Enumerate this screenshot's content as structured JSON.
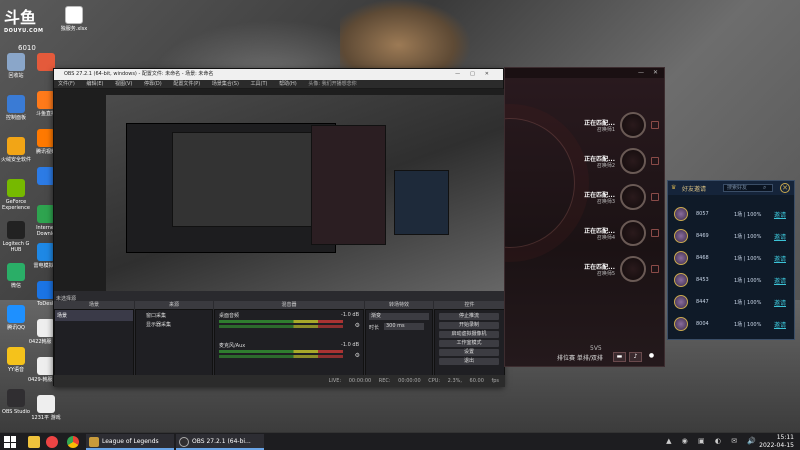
{
  "branding": {
    "logo_text": "斗鱼",
    "logo_sub": "DOUYU.COM",
    "room_id": "6010"
  },
  "desktop_icons": [
    {
      "label": "回收站",
      "color": "#8aa6c9"
    },
    {
      "label": "控制面板",
      "color": "#3a7bd5"
    },
    {
      "label": "火绒安全软件",
      "color": "#f2a516"
    },
    {
      "label": "GeForce Experience",
      "color": "#76b900"
    },
    {
      "label": "Logitech G HUB",
      "color": "#222"
    },
    {
      "label": "微信",
      "color": "#2aae67"
    },
    {
      "label": "腾讯QQ",
      "color": "#1e90ff"
    },
    {
      "label": "YY语音",
      "color": "#f5c21b"
    },
    {
      "label": "OBS Studio",
      "color": "#302e31"
    }
  ],
  "desktop_icons_col2": [
    {
      "label": "",
      "color": "#e45a3b"
    },
    {
      "label": "斗鱼直播",
      "color": "#ff7a1a"
    },
    {
      "label": "腾讯视频",
      "color": "#ff7900"
    },
    {
      "label": "",
      "color": "#2c7be5"
    },
    {
      "label": "Internet Downlo",
      "color": "#2ea44f"
    },
    {
      "label": "雷电模拟器",
      "color": "#1e88e5"
    },
    {
      "label": "ToDesk",
      "color": "#1b74e4"
    },
    {
      "label": "0422韩服 通用",
      "color": "#eee"
    },
    {
      "label": "0429-韩服 游戏",
      "color": "#eee"
    },
    {
      "label": "1231平 游戏",
      "color": "#eee"
    }
  ],
  "desktop_files_top": [
    {
      "label": "独服务.xlsx"
    },
    {
      "label": "独服务"
    }
  ],
  "obs": {
    "title": "OBS 27.2.1 (64-bit, windows) - 配置文件: 未命名 - 场景: 未命名",
    "menu": [
      "文件(F)",
      "编辑(E)",
      "视图(V)",
      "停靠(D)",
      "配置文件(P)",
      "场景集合(S)",
      "工具(T)",
      "帮助(H)"
    ],
    "menu_notice": "头像: 我们开播想念你",
    "preview_label": "未选择源",
    "dock_headers": {
      "scenes": "场景",
      "sources": "来源",
      "mixer": "混音器",
      "transitions": "转场特效",
      "controls": "控件"
    },
    "scenes": [
      "场景"
    ],
    "sources": [
      "窗口采集",
      "显示器采集"
    ],
    "mixer_tracks": [
      {
        "name": "桌面音频",
        "level": "-1.0 dB"
      },
      {
        "name": "麦克风/Aux",
        "level": "-1.0 dB"
      }
    ],
    "transition": {
      "type": "渐变",
      "duration_label": "时长",
      "duration": "300 ms"
    },
    "controls": [
      "停止推流",
      "开始录制",
      "启动虚拟摄像机",
      "工作室模式",
      "设置",
      "退出"
    ],
    "status": [
      "LIVE: 00:00:00",
      "REC: 00:00:00",
      "CPU: 2.3%, 60.00 fps"
    ]
  },
  "lol": {
    "slots": [
      {
        "label": "正在匹配...",
        "sub": "召唤师1"
      },
      {
        "label": "正在匹配...",
        "sub": "召唤师2"
      },
      {
        "label": "正在匹配...",
        "sub": "召唤师3"
      },
      {
        "label": "正在匹配...",
        "sub": "召唤师4"
      },
      {
        "label": "正在匹配...",
        "sub": "召唤师5"
      }
    ],
    "mode": "5V5",
    "queue": "排位赛 单排/双排"
  },
  "friends": {
    "title": "好友邀请",
    "search_placeholder": "搜索好友",
    "rows": [
      {
        "id": "8057",
        "status": "1场 | 100%",
        "action": "邀请"
      },
      {
        "id": "8469",
        "status": "1场 | 100%",
        "action": "邀请"
      },
      {
        "id": "8468",
        "status": "1场 | 100%",
        "action": "邀请"
      },
      {
        "id": "8453",
        "status": "1场 | 100%",
        "action": "邀请"
      },
      {
        "id": "8447",
        "status": "1场 | 100%",
        "action": "邀请"
      },
      {
        "id": "8004",
        "status": "1场 | 100%",
        "action": "邀请"
      }
    ]
  },
  "taskbar": {
    "apps": [
      {
        "label": "League of Legends",
        "color": "#c89b3c"
      },
      {
        "label": "OBS 27.2.1 (64-bi...",
        "color": "#302e31"
      }
    ],
    "time": "15:11",
    "date": "2022-04-15"
  }
}
